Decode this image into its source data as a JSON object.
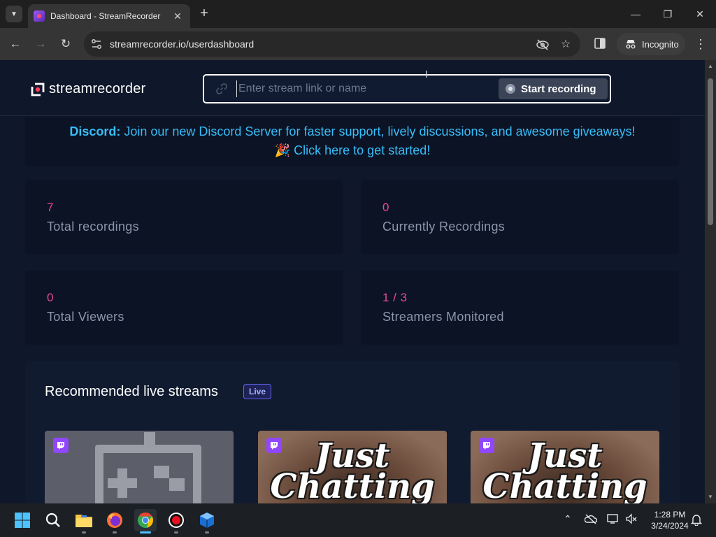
{
  "browser": {
    "tab_title": "Dashboard - StreamRecorder",
    "url": "streamrecorder.io/userdashboard",
    "incognito_label": "Incognito"
  },
  "page": {
    "logo_text": "streamrecorder",
    "search_placeholder": "Enter stream link or name",
    "start_button": "Start recording",
    "discord": {
      "bold": "Discord:",
      "text": " Join our new Discord Server for faster support, lively discussions, and awesome giveaways!",
      "cta": "🎉 Click here to get started!"
    },
    "stats": [
      {
        "value": "7",
        "label": "Total recordings"
      },
      {
        "value": "0",
        "label": "Currently Recordings"
      },
      {
        "value": "0",
        "label": "Total Viewers"
      },
      {
        "value": "1 / 3",
        "label": "Streamers Monitored"
      }
    ],
    "recommended": {
      "title": "Recommended live streams",
      "badge": "Live",
      "streams": [
        {
          "thumbnail_text": ""
        },
        {
          "thumbnail_text": "Just Chatting"
        },
        {
          "thumbnail_text": "Just Chatting"
        }
      ]
    }
  },
  "taskbar": {
    "time": "1:28 PM",
    "date": "3/24/2024"
  },
  "colors": {
    "page_bg": "#0f172a",
    "card_bg": "#0b1324",
    "accent_pink": "#ec4899",
    "accent_cyan": "#38bdf8",
    "live_badge": "#6366f1",
    "twitch": "#9146ff"
  }
}
